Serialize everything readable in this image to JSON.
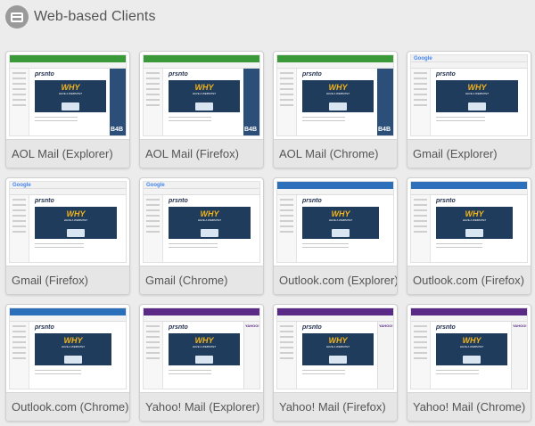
{
  "header": {
    "title": "Web-based Clients",
    "icon": "browser-window-icon"
  },
  "clients": [
    {
      "label": "AOL Mail (Explorer)",
      "style": "aol"
    },
    {
      "label": "AOL Mail (Firefox)",
      "style": "aol"
    },
    {
      "label": "AOL Mail (Chrome)",
      "style": "aol"
    },
    {
      "label": "Gmail (Explorer)",
      "style": "gmail"
    },
    {
      "label": "Gmail (Firefox)",
      "style": "gmail"
    },
    {
      "label": "Gmail (Chrome)",
      "style": "gmail"
    },
    {
      "label": "Outlook.com (Explorer)",
      "style": "outlook"
    },
    {
      "label": "Outlook.com (Firefox)",
      "style": "outlook"
    },
    {
      "label": "Outlook.com (Chrome)",
      "style": "outlook"
    },
    {
      "label": "Yahoo! Mail (Explorer)",
      "style": "yahoo"
    },
    {
      "label": "Yahoo! Mail (Firefox)",
      "style": "yahoo"
    },
    {
      "label": "Yahoo! Mail (Chrome)",
      "style": "yahoo"
    }
  ],
  "thumbnail": {
    "logo": "prsnto",
    "banner_headline": "WHY",
    "banner_sub": "HAVE A WEBSITE?",
    "gmail_logo": "Google",
    "yahoo_logo": "YAHOO!",
    "aol_ad_text": "B4B"
  },
  "colors": {
    "aol_bar": "#3a9a3a",
    "aol_ad": "#2c4f7a",
    "gmail_bar": "#f1f1f1",
    "outlook_bar": "#2c6fba",
    "yahoo_bar": "#5b2a86",
    "banner": "#1f3c5c",
    "banner_accent": "#f2b31c"
  }
}
